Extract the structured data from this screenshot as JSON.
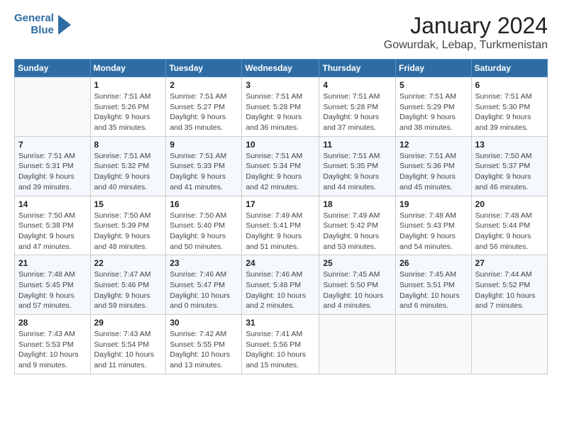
{
  "logo": {
    "line1": "General",
    "line2": "Blue"
  },
  "title": "January 2024",
  "subtitle": "Gowurdak, Lebap, Turkmenistan",
  "days_of_week": [
    "Sunday",
    "Monday",
    "Tuesday",
    "Wednesday",
    "Thursday",
    "Friday",
    "Saturday"
  ],
  "weeks": [
    [
      {
        "day": "",
        "info": ""
      },
      {
        "day": "1",
        "info": "Sunrise: 7:51 AM\nSunset: 5:26 PM\nDaylight: 9 hours\nand 35 minutes."
      },
      {
        "day": "2",
        "info": "Sunrise: 7:51 AM\nSunset: 5:27 PM\nDaylight: 9 hours\nand 35 minutes."
      },
      {
        "day": "3",
        "info": "Sunrise: 7:51 AM\nSunset: 5:28 PM\nDaylight: 9 hours\nand 36 minutes."
      },
      {
        "day": "4",
        "info": "Sunrise: 7:51 AM\nSunset: 5:28 PM\nDaylight: 9 hours\nand 37 minutes."
      },
      {
        "day": "5",
        "info": "Sunrise: 7:51 AM\nSunset: 5:29 PM\nDaylight: 9 hours\nand 38 minutes."
      },
      {
        "day": "6",
        "info": "Sunrise: 7:51 AM\nSunset: 5:30 PM\nDaylight: 9 hours\nand 39 minutes."
      }
    ],
    [
      {
        "day": "7",
        "info": "Sunrise: 7:51 AM\nSunset: 5:31 PM\nDaylight: 9 hours\nand 39 minutes."
      },
      {
        "day": "8",
        "info": "Sunrise: 7:51 AM\nSunset: 5:32 PM\nDaylight: 9 hours\nand 40 minutes."
      },
      {
        "day": "9",
        "info": "Sunrise: 7:51 AM\nSunset: 5:33 PM\nDaylight: 9 hours\nand 41 minutes."
      },
      {
        "day": "10",
        "info": "Sunrise: 7:51 AM\nSunset: 5:34 PM\nDaylight: 9 hours\nand 42 minutes."
      },
      {
        "day": "11",
        "info": "Sunrise: 7:51 AM\nSunset: 5:35 PM\nDaylight: 9 hours\nand 44 minutes."
      },
      {
        "day": "12",
        "info": "Sunrise: 7:51 AM\nSunset: 5:36 PM\nDaylight: 9 hours\nand 45 minutes."
      },
      {
        "day": "13",
        "info": "Sunrise: 7:50 AM\nSunset: 5:37 PM\nDaylight: 9 hours\nand 46 minutes."
      }
    ],
    [
      {
        "day": "14",
        "info": "Sunrise: 7:50 AM\nSunset: 5:38 PM\nDaylight: 9 hours\nand 47 minutes."
      },
      {
        "day": "15",
        "info": "Sunrise: 7:50 AM\nSunset: 5:39 PM\nDaylight: 9 hours\nand 48 minutes."
      },
      {
        "day": "16",
        "info": "Sunrise: 7:50 AM\nSunset: 5:40 PM\nDaylight: 9 hours\nand 50 minutes."
      },
      {
        "day": "17",
        "info": "Sunrise: 7:49 AM\nSunset: 5:41 PM\nDaylight: 9 hours\nand 51 minutes."
      },
      {
        "day": "18",
        "info": "Sunrise: 7:49 AM\nSunset: 5:42 PM\nDaylight: 9 hours\nand 53 minutes."
      },
      {
        "day": "19",
        "info": "Sunrise: 7:48 AM\nSunset: 5:43 PM\nDaylight: 9 hours\nand 54 minutes."
      },
      {
        "day": "20",
        "info": "Sunrise: 7:48 AM\nSunset: 5:44 PM\nDaylight: 9 hours\nand 56 minutes."
      }
    ],
    [
      {
        "day": "21",
        "info": "Sunrise: 7:48 AM\nSunset: 5:45 PM\nDaylight: 9 hours\nand 57 minutes."
      },
      {
        "day": "22",
        "info": "Sunrise: 7:47 AM\nSunset: 5:46 PM\nDaylight: 9 hours\nand 59 minutes."
      },
      {
        "day": "23",
        "info": "Sunrise: 7:46 AM\nSunset: 5:47 PM\nDaylight: 10 hours\nand 0 minutes."
      },
      {
        "day": "24",
        "info": "Sunrise: 7:46 AM\nSunset: 5:48 PM\nDaylight: 10 hours\nand 2 minutes."
      },
      {
        "day": "25",
        "info": "Sunrise: 7:45 AM\nSunset: 5:50 PM\nDaylight: 10 hours\nand 4 minutes."
      },
      {
        "day": "26",
        "info": "Sunrise: 7:45 AM\nSunset: 5:51 PM\nDaylight: 10 hours\nand 6 minutes."
      },
      {
        "day": "27",
        "info": "Sunrise: 7:44 AM\nSunset: 5:52 PM\nDaylight: 10 hours\nand 7 minutes."
      }
    ],
    [
      {
        "day": "28",
        "info": "Sunrise: 7:43 AM\nSunset: 5:53 PM\nDaylight: 10 hours\nand 9 minutes."
      },
      {
        "day": "29",
        "info": "Sunrise: 7:43 AM\nSunset: 5:54 PM\nDaylight: 10 hours\nand 11 minutes."
      },
      {
        "day": "30",
        "info": "Sunrise: 7:42 AM\nSunset: 5:55 PM\nDaylight: 10 hours\nand 13 minutes."
      },
      {
        "day": "31",
        "info": "Sunrise: 7:41 AM\nSunset: 5:56 PM\nDaylight: 10 hours\nand 15 minutes."
      },
      {
        "day": "",
        "info": ""
      },
      {
        "day": "",
        "info": ""
      },
      {
        "day": "",
        "info": ""
      }
    ]
  ]
}
